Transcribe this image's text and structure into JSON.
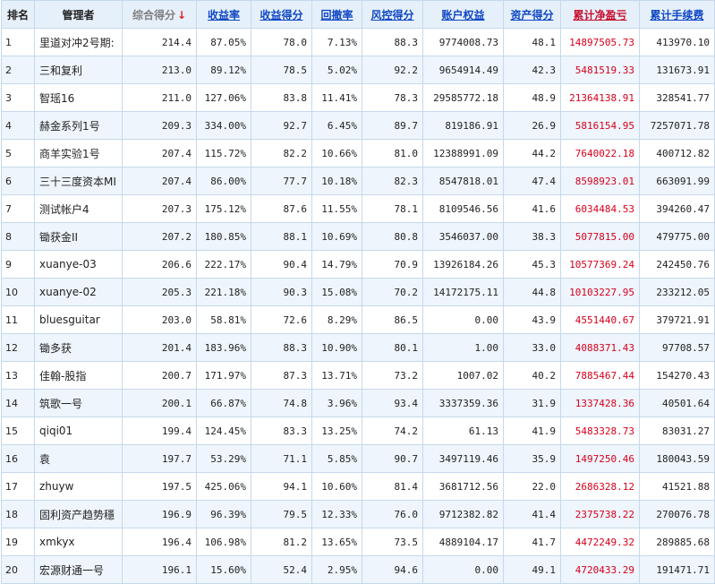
{
  "headers": {
    "rank": "排名",
    "manager": "管理者",
    "composite": "综合得分",
    "return_rate": "收益率",
    "return_score": "收益得分",
    "drawdown": "回撤率",
    "risk_score": "风控得分",
    "equity": "账户权益",
    "asset_score": "资产得分",
    "net_profit": "累计净盈亏",
    "fees": "累计手续费"
  },
  "sort_indicator": "↓",
  "rows": [
    {
      "rank": "1",
      "manager": "里道对冲2号期:",
      "composite": "214.4",
      "return_rate": "87.05%",
      "return_score": "78.0",
      "drawdown": "7.13%",
      "risk_score": "88.3",
      "equity": "9774008.73",
      "asset_score": "48.1",
      "net_profit": "14897505.73",
      "fees": "413970.10"
    },
    {
      "rank": "2",
      "manager": "三和复利",
      "composite": "213.0",
      "return_rate": "89.12%",
      "return_score": "78.5",
      "drawdown": "5.02%",
      "risk_score": "92.2",
      "equity": "9654914.49",
      "asset_score": "42.3",
      "net_profit": "5481519.33",
      "fees": "131673.91"
    },
    {
      "rank": "3",
      "manager": "智瑶16",
      "composite": "211.0",
      "return_rate": "127.06%",
      "return_score": "83.8",
      "drawdown": "11.41%",
      "risk_score": "78.3",
      "equity": "29585772.18",
      "asset_score": "48.9",
      "net_profit": "21364138.91",
      "fees": "328541.77"
    },
    {
      "rank": "4",
      "manager": "赫金系列1号",
      "composite": "209.3",
      "return_rate": "334.00%",
      "return_score": "92.7",
      "drawdown": "6.45%",
      "risk_score": "89.7",
      "equity": "819186.91",
      "asset_score": "26.9",
      "net_profit": "5816154.95",
      "fees": "7257071.78"
    },
    {
      "rank": "5",
      "manager": "商羊实验1号",
      "composite": "207.4",
      "return_rate": "115.72%",
      "return_score": "82.2",
      "drawdown": "10.66%",
      "risk_score": "81.0",
      "equity": "12388991.09",
      "asset_score": "44.2",
      "net_profit": "7640022.18",
      "fees": "400712.82"
    },
    {
      "rank": "6",
      "manager": "三十三度资本MI",
      "composite": "207.4",
      "return_rate": "86.00%",
      "return_score": "77.7",
      "drawdown": "10.18%",
      "risk_score": "82.3",
      "equity": "8547818.01",
      "asset_score": "47.4",
      "net_profit": "8598923.01",
      "fees": "663091.99"
    },
    {
      "rank": "7",
      "manager": "测试帐户4",
      "composite": "207.3",
      "return_rate": "175.12%",
      "return_score": "87.6",
      "drawdown": "11.55%",
      "risk_score": "78.1",
      "equity": "8109546.56",
      "asset_score": "41.6",
      "net_profit": "6034484.53",
      "fees": "394260.47"
    },
    {
      "rank": "8",
      "manager": "锄获金II",
      "composite": "207.2",
      "return_rate": "180.85%",
      "return_score": "88.1",
      "drawdown": "10.69%",
      "risk_score": "80.8",
      "equity": "3546037.00",
      "asset_score": "38.3",
      "net_profit": "5077815.00",
      "fees": "479775.00"
    },
    {
      "rank": "9",
      "manager": "xuanye-03",
      "composite": "206.6",
      "return_rate": "222.17%",
      "return_score": "90.4",
      "drawdown": "14.79%",
      "risk_score": "70.9",
      "equity": "13926184.26",
      "asset_score": "45.3",
      "net_profit": "10577369.24",
      "fees": "242450.76"
    },
    {
      "rank": "10",
      "manager": "xuanye-02",
      "composite": "205.3",
      "return_rate": "221.18%",
      "return_score": "90.3",
      "drawdown": "15.08%",
      "risk_score": "70.2",
      "equity": "14172175.11",
      "asset_score": "44.8",
      "net_profit": "10103227.95",
      "fees": "233212.05"
    },
    {
      "rank": "11",
      "manager": "bluesguitar",
      "composite": "203.0",
      "return_rate": "58.81%",
      "return_score": "72.6",
      "drawdown": "8.29%",
      "risk_score": "86.5",
      "equity": "0.00",
      "asset_score": "43.9",
      "net_profit": "4551440.67",
      "fees": "379721.91"
    },
    {
      "rank": "12",
      "manager": "锄多获",
      "composite": "201.4",
      "return_rate": "183.96%",
      "return_score": "88.3",
      "drawdown": "10.90%",
      "risk_score": "80.1",
      "equity": "1.00",
      "asset_score": "33.0",
      "net_profit": "4088371.43",
      "fees": "97708.57"
    },
    {
      "rank": "13",
      "manager": "佳翰-股指",
      "composite": "200.7",
      "return_rate": "171.97%",
      "return_score": "87.3",
      "drawdown": "13.71%",
      "risk_score": "73.2",
      "equity": "1007.02",
      "asset_score": "40.2",
      "net_profit": "7885467.44",
      "fees": "154270.43"
    },
    {
      "rank": "14",
      "manager": "筑歌一号",
      "composite": "200.1",
      "return_rate": "66.87%",
      "return_score": "74.8",
      "drawdown": "3.96%",
      "risk_score": "93.4",
      "equity": "3337359.36",
      "asset_score": "31.9",
      "net_profit": "1337428.36",
      "fees": "40501.64"
    },
    {
      "rank": "15",
      "manager": "qiqi01",
      "composite": "199.4",
      "return_rate": "124.45%",
      "return_score": "83.3",
      "drawdown": "13.25%",
      "risk_score": "74.2",
      "equity": "61.13",
      "asset_score": "41.9",
      "net_profit": "5483328.73",
      "fees": "83031.27"
    },
    {
      "rank": "16",
      "manager": "袁",
      "composite": "197.7",
      "return_rate": "53.29%",
      "return_score": "71.1",
      "drawdown": "5.85%",
      "risk_score": "90.7",
      "equity": "3497119.46",
      "asset_score": "35.9",
      "net_profit": "1497250.46",
      "fees": "180043.59"
    },
    {
      "rank": "17",
      "manager": "zhuyw",
      "composite": "197.5",
      "return_rate": "425.06%",
      "return_score": "94.1",
      "drawdown": "10.60%",
      "risk_score": "81.4",
      "equity": "3681712.56",
      "asset_score": "22.0",
      "net_profit": "2686328.12",
      "fees": "41521.88"
    },
    {
      "rank": "18",
      "manager": "固利资产趋势穩",
      "composite": "196.9",
      "return_rate": "96.39%",
      "return_score": "79.5",
      "drawdown": "12.33%",
      "risk_score": "76.0",
      "equity": "9712382.82",
      "asset_score": "41.4",
      "net_profit": "2375738.22",
      "fees": "270076.78"
    },
    {
      "rank": "19",
      "manager": "xmkyx",
      "composite": "196.4",
      "return_rate": "106.98%",
      "return_score": "81.2",
      "drawdown": "13.65%",
      "risk_score": "73.5",
      "equity": "4889104.17",
      "asset_score": "41.7",
      "net_profit": "4472249.32",
      "fees": "289885.68"
    },
    {
      "rank": "20",
      "manager": "宏源财通一号",
      "composite": "196.1",
      "return_rate": "15.60%",
      "return_score": "52.4",
      "drawdown": "2.95%",
      "risk_score": "94.6",
      "equity": "0.00",
      "asset_score": "49.1",
      "net_profit": "4720433.29",
      "fees": "191471.71"
    }
  ]
}
